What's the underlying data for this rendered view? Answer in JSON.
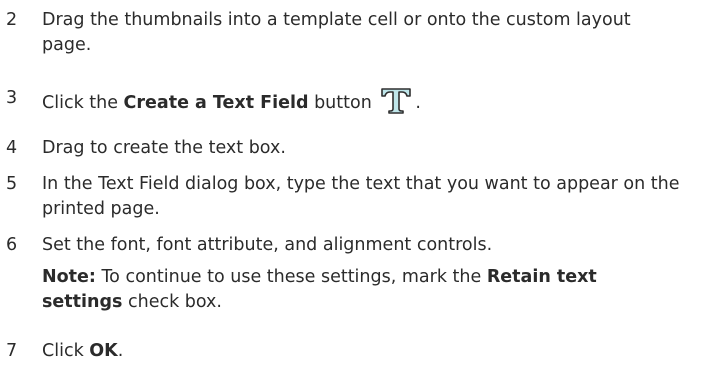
{
  "steps": [
    {
      "number": "2",
      "text": "Drag the thumbnails into a template cell or onto the custom layout page."
    },
    {
      "number": "3",
      "prefix": "Click the ",
      "bold": "Create a Text Field",
      "suffix": " button",
      "end": ".",
      "icon": "text-field-t-icon"
    },
    {
      "number": "4",
      "text": "Drag to create the text box."
    },
    {
      "number": "5",
      "text": "In the Text Field dialog box, type the text that you want to appear on the printed page."
    },
    {
      "number": "6",
      "text": "Set the font, font attribute, and alignment controls.",
      "note_label": "Note:",
      "note_text": "  To continue to use these settings, mark the ",
      "note_bold": "Retain text settings",
      "note_end": " check box."
    },
    {
      "number": "7",
      "prefix": "Click ",
      "bold": "OK",
      "end": "."
    }
  ],
  "colors": {
    "text": "#2b2b2b",
    "icon_fill": "#bfe6ea",
    "icon_stroke": "#2f2f2f"
  }
}
